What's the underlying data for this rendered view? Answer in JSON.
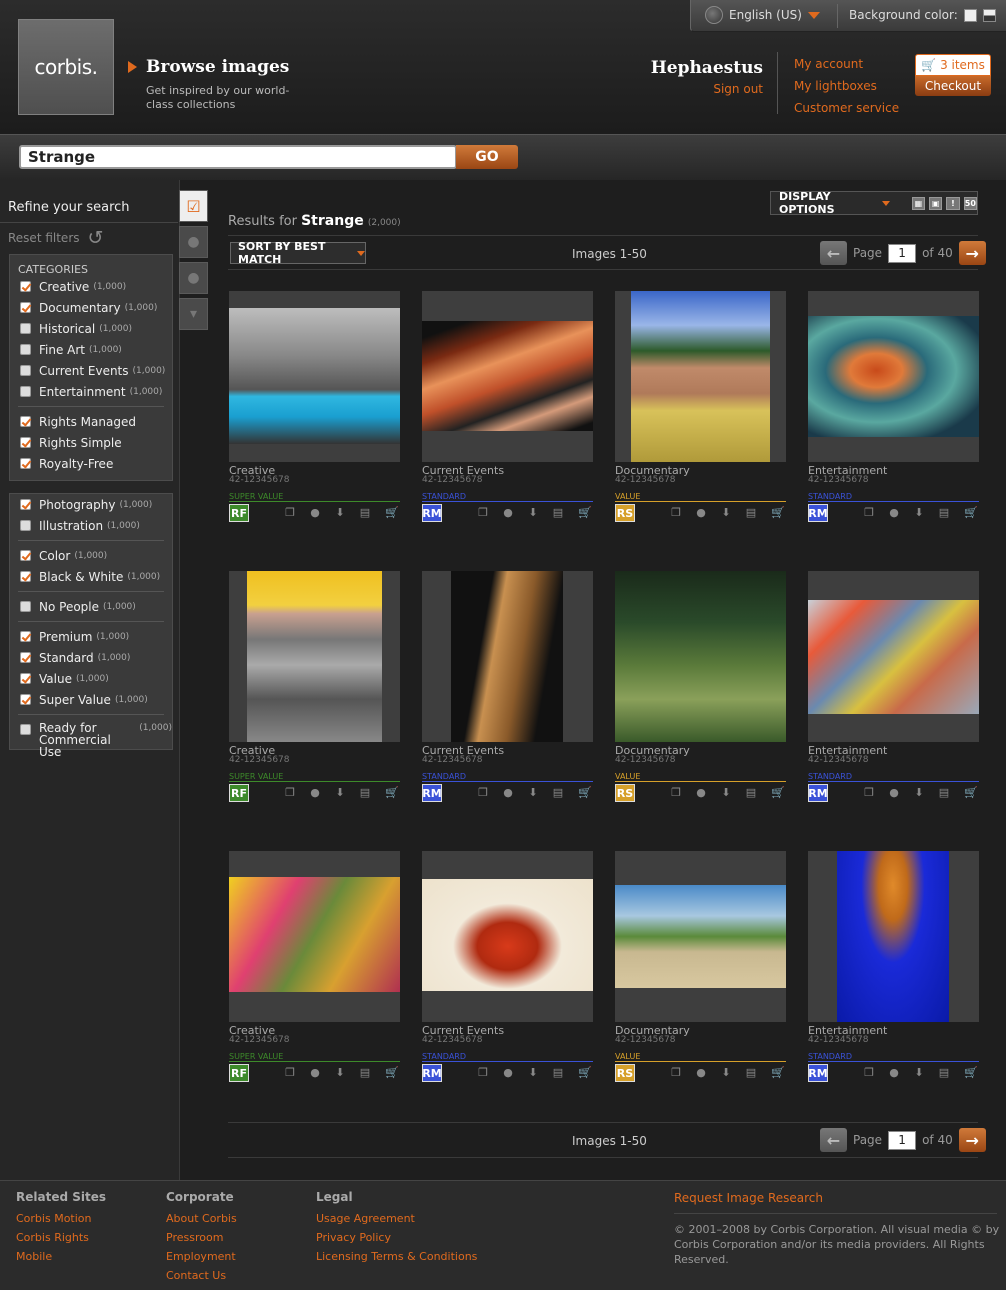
{
  "header": {
    "logo_text": "corbis.",
    "browse_title": "Browse images",
    "browse_sub": "Get inspired by our world-class collections",
    "language": "English (US)",
    "bg_color_label": "Background color:",
    "username": "Hephaestus",
    "sign_out": "Sign out",
    "my_account": "My account",
    "my_lightboxes": "My lightboxes",
    "customer_service": "Customer service",
    "cart_items": "3 items",
    "checkout": "Checkout"
  },
  "search": {
    "value": "Strange",
    "go": "GO"
  },
  "sidebar": {
    "refine": "Refine your search",
    "reset": "Reset filters",
    "categories_header": "CATEGORIES",
    "groups": [
      [
        {
          "label": "Creative",
          "count": "(1,000)",
          "checked": true
        },
        {
          "label": "Documentary",
          "count": "(1,000)",
          "checked": true
        },
        {
          "label": "Historical",
          "count": "(1,000)",
          "checked": false
        },
        {
          "label": "Fine Art",
          "count": "(1,000)",
          "checked": false
        },
        {
          "label": "Current Events",
          "count": "(1,000)",
          "checked": false
        },
        {
          "label": "Entertainment",
          "count": "(1,000)",
          "checked": false
        },
        {
          "label": "Rights Managed",
          "count": "",
          "checked": true
        },
        {
          "label": "Rights Simple",
          "count": "",
          "checked": true
        },
        {
          "label": "Royalty-Free",
          "count": "",
          "checked": true
        }
      ],
      [
        {
          "label": "Photography",
          "count": "(1,000)",
          "checked": true
        },
        {
          "label": "Illustration",
          "count": "(1,000)",
          "checked": false
        },
        {
          "label": "Color",
          "count": "(1,000)",
          "checked": true
        },
        {
          "label": "Black & White",
          "count": "(1,000)",
          "checked": true
        },
        {
          "label": "No People",
          "count": "(1,000)",
          "checked": false
        },
        {
          "label": "Premium",
          "count": "(1,000)",
          "checked": true
        },
        {
          "label": "Standard",
          "count": "(1,000)",
          "checked": true
        },
        {
          "label": "Value",
          "count": "(1,000)",
          "checked": true
        },
        {
          "label": "Super Value",
          "count": "(1,000)",
          "checked": true
        },
        {
          "label": "Ready for Commercial Use",
          "count": "(1,000)",
          "checked": false
        }
      ]
    ]
  },
  "results": {
    "prefix": "Results for",
    "query": "Strange",
    "count": "(2,000)",
    "display_options": "DISPLAY OPTIONS",
    "per_page": "50",
    "sort": "SORT BY BEST MATCH",
    "range": "Images 1-50",
    "page_label": "Page",
    "page_value": "1",
    "page_of": "of 40"
  },
  "images": [
    {
      "category": "Creative",
      "id": "42-12345678",
      "license": "SUPER VALUE",
      "badge": "RF",
      "color": "#3d8a2a"
    },
    {
      "category": "Current Events",
      "id": "42-12345678",
      "license": "STANDARD",
      "badge": "RM",
      "color": "#3a52d8"
    },
    {
      "category": "Documentary",
      "id": "42-12345678",
      "license": "VALUE",
      "badge": "RS",
      "color": "#d6a02a"
    },
    {
      "category": "Entertainment",
      "id": "42-12345678",
      "license": "STANDARD",
      "badge": "RM",
      "color": "#3a52d8"
    },
    {
      "category": "Creative",
      "id": "42-12345678",
      "license": "SUPER VALUE",
      "badge": "RF",
      "color": "#3d8a2a"
    },
    {
      "category": "Current Events",
      "id": "42-12345678",
      "license": "STANDARD",
      "badge": "RM",
      "color": "#3a52d8"
    },
    {
      "category": "Documentary",
      "id": "42-12345678",
      "license": "VALUE",
      "badge": "RS",
      "color": "#d6a02a"
    },
    {
      "category": "Entertainment",
      "id": "42-12345678",
      "license": "STANDARD",
      "badge": "RM",
      "color": "#3a52d8"
    },
    {
      "category": "Creative",
      "id": "42-12345678",
      "license": "SUPER VALUE",
      "badge": "RF",
      "color": "#3d8a2a"
    },
    {
      "category": "Current Events",
      "id": "42-12345678",
      "license": "STANDARD",
      "badge": "RM",
      "color": "#3a52d8"
    },
    {
      "category": "Documentary",
      "id": "42-12345678",
      "license": "VALUE",
      "badge": "RS",
      "color": "#d6a02a"
    },
    {
      "category": "Entertainment",
      "id": "42-12345678",
      "license": "STANDARD",
      "badge": "RM",
      "color": "#3a52d8"
    }
  ],
  "footer": {
    "related_title": "Related Sites",
    "related": [
      "Corbis Motion",
      "Corbis Rights",
      "Mobile"
    ],
    "corporate_title": "Corporate",
    "corporate": [
      "About Corbis",
      "Pressroom",
      "Employment",
      "Contact Us"
    ],
    "legal_title": "Legal",
    "legal": [
      "Usage Agreement",
      "Privacy Policy",
      "Licensing Terms & Conditions"
    ],
    "research": "Request Image Research",
    "copyright": "© 2001–2008 by Corbis Corporation. All visual media © by Corbis Corporation and/or its media providers. All Rights Reserved."
  },
  "colors": {
    "accent": "#e06a1e"
  }
}
